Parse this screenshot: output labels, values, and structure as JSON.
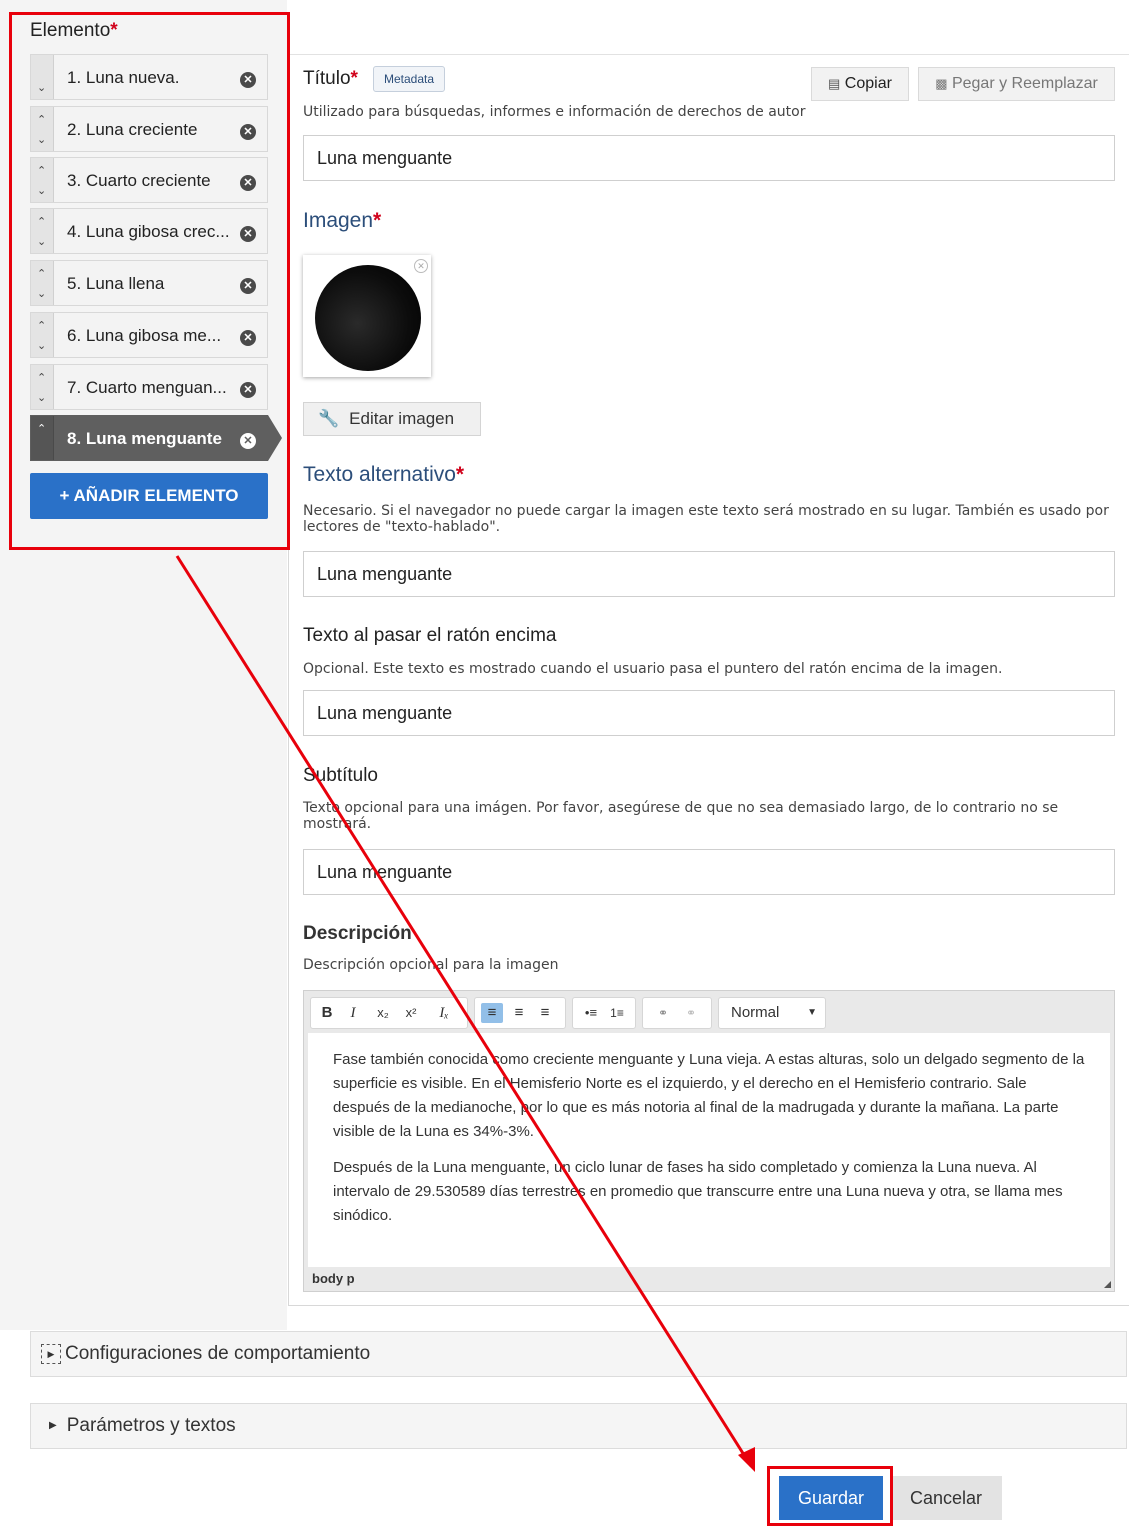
{
  "sidebar": {
    "title": "Elemento",
    "required_mark": "*",
    "items": [
      {
        "label": "1. Luna nueva."
      },
      {
        "label": "2. Luna creciente"
      },
      {
        "label": "3. Cuarto creciente"
      },
      {
        "label": "4. Luna gibosa crec..."
      },
      {
        "label": "5. Luna llena"
      },
      {
        "label": "6. Luna gibosa me..."
      },
      {
        "label": "7. Cuarto menguan..."
      },
      {
        "label": "8. Luna menguante"
      }
    ],
    "add_button": "+ AÑADIR ELEMENTO"
  },
  "form": {
    "titulo_label": "Título",
    "metadata_badge": "Metadata",
    "copy_button": "Copiar",
    "paste_button": "Pegar y Reemplazar",
    "titulo_help": "Utilizado para búsquedas, informes e información de derechos de autor",
    "titulo_value": "Luna menguante",
    "imagen_label": "Imagen",
    "edit_image_button": "Editar imagen",
    "alt_label": "Texto alternativo",
    "alt_help": "Necesario. Si el navegador no puede cargar la imagen este texto será mostrado en su lugar. También es usado por lectores de \"texto-hablado\".",
    "alt_value": "Luna menguante",
    "hover_label": "Texto al pasar el ratón encima",
    "hover_help": "Opcional. Este texto es mostrado cuando el usuario pasa el puntero del ratón encima de la imagen.",
    "hover_value": "Luna menguante",
    "subtitle_label": "Subtítulo",
    "subtitle_help": "Texto opcional para una imágen. Por favor, asegúrese de que no sea demasiado largo, de lo contrario no se mostrará.",
    "subtitle_value": "Luna menguante",
    "desc_label": "Descripción",
    "desc_help": "Descripción opcional para la imagen",
    "editor_format": "Normal",
    "editor_paragraphs": [
      "Fase también conocida como creciente menguante y Luna vieja. A estas alturas, solo un delgado segmento de la superficie es visible. En el Hemisferio Norte es el izquierdo, y el derecho en el Hemisferio contrario. Sale después de la medianoche, por lo que es más notoria al final de la madrugada y durante la mañana. La parte visible de la Luna es 34%-3%.",
      "Después de la Luna menguante, un ciclo lunar de fases ha sido completado y comienza la Luna nueva. Al intervalo de 29.530589 días terrestres en promedio que transcurre entre una Luna nueva y otra, se llama mes sinódico."
    ],
    "editor_path": "body  p"
  },
  "sections": {
    "behaviour": "Configuraciones de comportamiento",
    "params": "Parámetros y textos"
  },
  "footer": {
    "save": "Guardar",
    "cancel": "Cancelar"
  },
  "colors": {
    "accent": "#2a71c8",
    "annotation": "#e8000b",
    "required": "#d0021b"
  }
}
